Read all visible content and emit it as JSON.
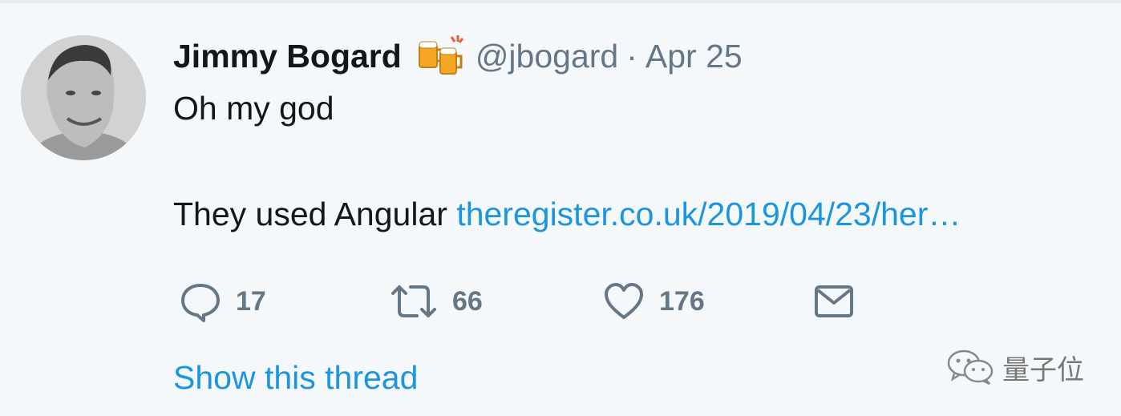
{
  "tweet": {
    "author_name": "Jimmy Bogard",
    "author_emoji": "beer-mugs-emoji",
    "handle": "@jbogard",
    "separator": "·",
    "date": "Apr 25",
    "text_line1": "Oh my god",
    "text_line2": "They used Angular",
    "link_text": "theregister.co.uk/2019/04/23/her…",
    "show_thread": "Show this thread"
  },
  "actions": {
    "reply": {
      "icon": "reply-icon",
      "count": "17"
    },
    "retweet": {
      "icon": "retweet-icon",
      "count": "66"
    },
    "like": {
      "icon": "heart-icon",
      "count": "176"
    },
    "message": {
      "icon": "mail-icon"
    }
  },
  "watermark": {
    "text": "量子位",
    "icon": "wechat-icon"
  },
  "colors": {
    "background": "#f5f8fa",
    "text": "#14171a",
    "muted": "#657786",
    "link": "#1b95e0"
  }
}
